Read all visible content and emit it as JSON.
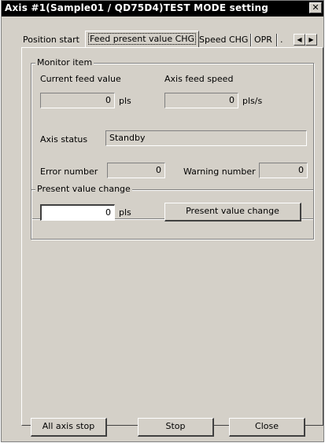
{
  "window": {
    "title": "Axis #1(Sample01 / QD75D4)TEST MODE setting",
    "close_glyph": "✕"
  },
  "tabs": [
    {
      "label": "Position start"
    },
    {
      "label": "Feed present value CHG"
    },
    {
      "label": "Speed CHG"
    },
    {
      "label": "OPR"
    },
    {
      "label": "."
    }
  ],
  "tab_scroll": {
    "left": "◀",
    "right": "▶"
  },
  "monitor": {
    "group_label": "Monitor item",
    "current_feed_label": "Current feed value",
    "current_feed_value": "0",
    "current_feed_unit": "pls",
    "axis_feed_speed_label": "Axis feed speed",
    "axis_feed_speed_value": "0",
    "axis_feed_speed_unit": "pls/s",
    "axis_status_label": "Axis status",
    "axis_status_value": "Standby",
    "error_number_label": "Error number",
    "error_number_value": "0",
    "warning_number_label": "Warning number",
    "warning_number_value": "0"
  },
  "present_value_change": {
    "group_label": "Present value change",
    "input_value": "0",
    "unit": "pls",
    "button_label": "Present value change"
  },
  "footer": {
    "all_axis_stop": "All axis stop",
    "stop": "Stop",
    "close": "Close"
  }
}
